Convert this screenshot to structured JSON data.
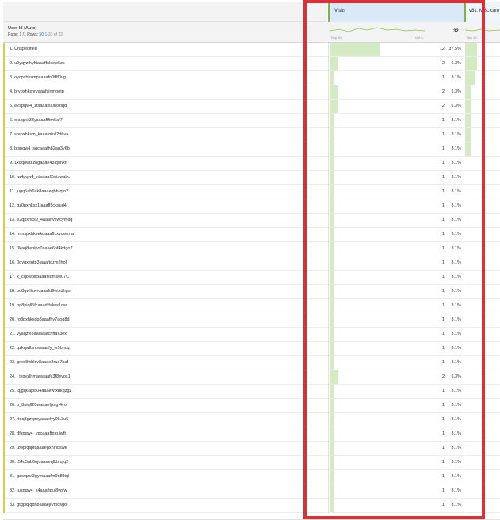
{
  "header": {
    "col_visits": "Visits",
    "col_v81": "v81: MBL cam",
    "dimension_title": "User Id (Auto)",
    "page_label": "Page: 1 /1",
    "rows_label": "Rows:",
    "rows_value": "50",
    "range_label": "1-33 of 33",
    "total_visits": "32",
    "spark_start": "Sep 30",
    "spark_end": "Oct 6",
    "spark_v81_start": "Sep 30"
  },
  "rows": [
    {
      "label": "1. Unspecified",
      "value": "12",
      "pct": "37.5%",
      "frac": 0.375,
      "v81": 0.35
    },
    {
      "label": "2. u9yqyzlhyhlaaaffolcew6zs",
      "value": "2",
      "pct": "6.3%",
      "frac": 0.063,
      "v81": 0.35
    },
    {
      "label": "3. oycpxhksmpsaaafo0fflf0vg",
      "value": "1",
      "pct": "3.1%",
      "frac": 0.031,
      "v81": 0.3
    },
    {
      "label": "4. brypxhksnryaaafsjnmootp",
      "value": "2",
      "pct": "6.3%",
      "frac": 0.063,
      "v81": 0.15
    },
    {
      "label": "5. e2spqw4_ztsaaafsl0hozlqd",
      "value": "2",
      "pct": "6.3%",
      "frac": 0.063,
      "v81": 0.15
    },
    {
      "label": "6. okuqzvl33ycaaaffftm6af7l",
      "value": "1",
      "pct": "3.1%",
      "frac": 0.031,
      "v81": 0.15
    },
    {
      "label": "7. srapxhksm_kaaafobsl2d6va",
      "value": "1",
      "pct": "3.1%",
      "frac": 0.031,
      "v81": 0.15
    },
    {
      "label": "8. bjspqw4_sqcaaafh82ag3y6b",
      "value": "1",
      "pct": "3.1%",
      "frac": 0.031,
      "v81": 0.15
    },
    {
      "label": "9. 1x8q8wblz8gaaae43lqohxrl",
      "value": "1",
      "pct": "3.1%",
      "frac": 0.031,
      "v81": 0
    },
    {
      "label": "10. lw4pqw4_rdsaaaf2wtswabc",
      "value": "1",
      "pct": "3.1%",
      "frac": 0.031,
      "v81": 0
    },
    {
      "label": "11. jugq5ab6ak8aaaeqbhrqto2",
      "value": "1",
      "pct": "3.1%",
      "frac": 0.031,
      "v81": 0
    },
    {
      "label": "12. gz0pxhksx1laaafl5cksud4l",
      "value": "1",
      "pct": "3.1%",
      "frac": 0.031,
      "v81": 0
    },
    {
      "label": "13. e2qpxhks9_4aaaflvxwcymdq",
      "value": "1",
      "pct": "3.1%",
      "frac": 0.031,
      "v81": 0
    },
    {
      "label": "14. mmspxhksekqaaaffcxvcxema",
      "value": "1",
      "pct": "3.1%",
      "frac": 0.031,
      "v81": 0
    },
    {
      "label": "15. 0kaq8wblpo0aaae6nf4kdgo7",
      "value": "1",
      "pct": "3.1%",
      "frac": 0.031,
      "v81": 0
    },
    {
      "label": "16. 0qyqxeqtp3laaaftgzm2hol",
      "value": "1",
      "pct": "3.1%",
      "frac": 0.031,
      "v81": 0
    },
    {
      "label": "17. x_cq8wbllclaaafsdfhsw07C",
      "value": "1",
      "pct": "3.1%",
      "frac": 0.031,
      "v81": 0
    },
    {
      "label": "18. od8qwllswrqaaafd9wtxdhgm",
      "value": "1",
      "pct": "3.1%",
      "frac": 0.031,
      "v81": 0
    },
    {
      "label": "19. hp8piqll5fcaaad.falws1ow",
      "value": "1",
      "pct": "3.1%",
      "frac": 0.031,
      "v81": 0
    },
    {
      "label": "20. ro8pxhksdq8aaafhy7aog8d",
      "value": "1",
      "pct": "3.1%",
      "frac": 0.031,
      "v81": 0
    },
    {
      "label": "21. vyaqzvl3aalaaafcnffax3ex",
      "value": "1",
      "pct": "3.1%",
      "frac": 0.031,
      "v81": 0
    },
    {
      "label": "22. qzkqwllsnpwaaafy_lv5bncq",
      "value": "1",
      "pct": "3.1%",
      "frac": 0.031,
      "v81": 0
    },
    {
      "label": "23. greq8wblcv8aaae2rae7buf",
      "value": "1",
      "pct": "3.1%",
      "frac": 0.031,
      "v81": 0
    },
    {
      "label": "24. _tkqyzlhmawaaafc3f8eyos1",
      "value": "2",
      "pct": "6.3%",
      "frac": 0.063,
      "v81": 0
    },
    {
      "label": "25. lqjgq6ajbb04aaaewtxdkqzgz",
      "value": "1",
      "pct": "3.1%",
      "frac": 0.031,
      "v81": 0
    },
    {
      "label": "26. p_8piqll28waaaeljkxgt4vo",
      "value": "1",
      "pct": "3.1%",
      "frac": 0.031,
      "v81": 0
    },
    {
      "label": "27. rtoq8gzypsyaaaelyy0k.3u5",
      "value": "1",
      "pct": "3.1%",
      "frac": 0.031,
      "v81": 0
    },
    {
      "label": "28. dfspqw4_ypcaaaftp.p.iwft",
      "value": "1",
      "pct": "3.1%",
      "frac": 0.031,
      "v81": 0
    },
    {
      "label": "29. jzwplqllptqaaaegxhlndswe",
      "value": "1",
      "pct": "3.1%",
      "frac": 0.031,
      "v81": 0
    },
    {
      "label": "30. t54q5ab6ojuaaaeqfkb.qfq2",
      "value": "1",
      "pct": "3.1%",
      "frac": 0.031,
      "v81": 0
    },
    {
      "label": "31. gzwqzvl3gymaaafm9q8tltql",
      "value": "1",
      "pct": "3.1%",
      "frac": 0.031,
      "v81": 0
    },
    {
      "label": "32. tuspqw4_x4aaaftpul8vofw",
      "value": "1",
      "pct": "3.1%",
      "frac": 0.031,
      "v81": 0
    },
    {
      "label": "33. gtgplqlqdn8aaaejrvmdsgoj",
      "value": "1",
      "pct": "3.1%",
      "frac": 0.031,
      "v81": 0
    }
  ],
  "colors": {
    "bar": "#d3eac3",
    "header_selected": "#d8e9f7",
    "metric_marker": "#7cb342",
    "highlight_border": "#e02d36",
    "link_blue": "#1473e6"
  }
}
